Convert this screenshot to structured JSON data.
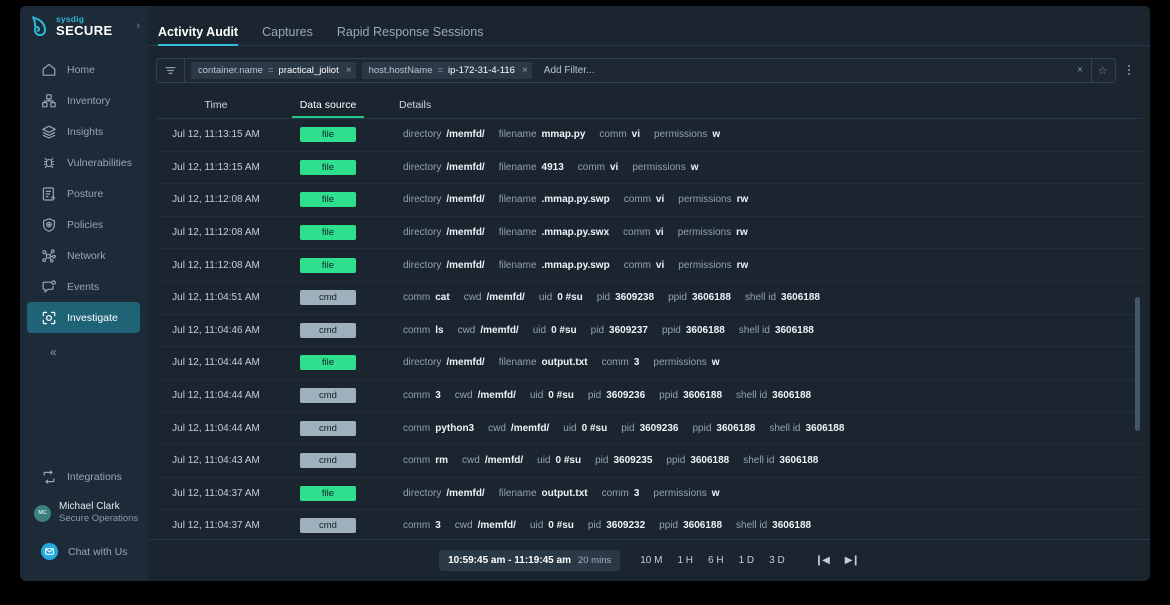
{
  "brand": {
    "top": "sysdig",
    "bottom": "SECURE",
    "chevron": "›"
  },
  "sidebar": {
    "items": [
      {
        "label": "Home",
        "icon": "home-icon"
      },
      {
        "label": "Inventory",
        "icon": "inventory-icon"
      },
      {
        "label": "Insights",
        "icon": "insights-icon"
      },
      {
        "label": "Vulnerabilities",
        "icon": "bug-icon"
      },
      {
        "label": "Posture",
        "icon": "posture-icon"
      },
      {
        "label": "Policies",
        "icon": "shield-icon"
      },
      {
        "label": "Network",
        "icon": "network-icon"
      },
      {
        "label": "Events",
        "icon": "events-icon"
      },
      {
        "label": "Investigate",
        "icon": "investigate-icon",
        "active": true
      }
    ],
    "collapse_glyph": "«",
    "integrations": {
      "label": "Integrations",
      "icon": "integrations-icon"
    },
    "user": {
      "initials": "MC",
      "name": "Michael Clark",
      "role": "Secure Operations"
    },
    "chat": {
      "label": "Chat with Us",
      "icon": "chat-icon"
    }
  },
  "tabs": [
    {
      "label": "Activity Audit",
      "active": true
    },
    {
      "label": "Captures",
      "active": false
    },
    {
      "label": "Rapid Response Sessions",
      "active": false
    }
  ],
  "filterbar": {
    "funnel_icon": "filter-icon",
    "chips": [
      {
        "key": "container.name",
        "op": "=",
        "value": "practical_joliot",
        "remove": "×"
      },
      {
        "key": "host.hostName",
        "op": "=",
        "value": "ip-172-31-4-116",
        "remove": "×"
      }
    ],
    "add_filter": "Add Filter...",
    "clear_glyph": "×",
    "star_glyph": "☆",
    "kebab_icon": "more-options-icon"
  },
  "table": {
    "columns": [
      {
        "label": "Time",
        "sorted": false
      },
      {
        "label": "Data source",
        "sorted": true
      },
      {
        "label": "Details",
        "sorted": false
      }
    ],
    "rows": [
      {
        "time": "Jul 12, 11:13:15 AM",
        "source": "file",
        "details": [
          [
            "directory",
            "/memfd/"
          ],
          [
            "filename",
            "mmap.py"
          ],
          [
            "comm",
            "vi"
          ],
          [
            "permissions",
            "w"
          ]
        ]
      },
      {
        "time": "Jul 12, 11:13:15 AM",
        "source": "file",
        "details": [
          [
            "directory",
            "/memfd/"
          ],
          [
            "filename",
            "4913"
          ],
          [
            "comm",
            "vi"
          ],
          [
            "permissions",
            "w"
          ]
        ]
      },
      {
        "time": "Jul 12, 11:12:08 AM",
        "source": "file",
        "details": [
          [
            "directory",
            "/memfd/"
          ],
          [
            "filename",
            ".mmap.py.swp"
          ],
          [
            "comm",
            "vi"
          ],
          [
            "permissions",
            "rw"
          ]
        ]
      },
      {
        "time": "Jul 12, 11:12:08 AM",
        "source": "file",
        "details": [
          [
            "directory",
            "/memfd/"
          ],
          [
            "filename",
            ".mmap.py.swx"
          ],
          [
            "comm",
            "vi"
          ],
          [
            "permissions",
            "rw"
          ]
        ]
      },
      {
        "time": "Jul 12, 11:12:08 AM",
        "source": "file",
        "details": [
          [
            "directory",
            "/memfd/"
          ],
          [
            "filename",
            ".mmap.py.swp"
          ],
          [
            "comm",
            "vi"
          ],
          [
            "permissions",
            "rw"
          ]
        ]
      },
      {
        "time": "Jul 12, 11:04:51 AM",
        "source": "cmd",
        "details": [
          [
            "comm",
            "cat"
          ],
          [
            "cwd",
            "/memfd/"
          ],
          [
            "uid",
            "0 #su"
          ],
          [
            "pid",
            "3609238"
          ],
          [
            "ppid",
            "3606188"
          ],
          [
            "shell id",
            "3606188"
          ]
        ]
      },
      {
        "time": "Jul 12, 11:04:46 AM",
        "source": "cmd",
        "details": [
          [
            "comm",
            "ls"
          ],
          [
            "cwd",
            "/memfd/"
          ],
          [
            "uid",
            "0 #su"
          ],
          [
            "pid",
            "3609237"
          ],
          [
            "ppid",
            "3606188"
          ],
          [
            "shell id",
            "3606188"
          ]
        ]
      },
      {
        "time": "Jul 12, 11:04:44 AM",
        "source": "file",
        "details": [
          [
            "directory",
            "/memfd/"
          ],
          [
            "filename",
            "output.txt"
          ],
          [
            "comm",
            "3"
          ],
          [
            "permissions",
            "w"
          ]
        ]
      },
      {
        "time": "Jul 12, 11:04:44 AM",
        "source": "cmd",
        "details": [
          [
            "comm",
            "3"
          ],
          [
            "cwd",
            "/memfd/"
          ],
          [
            "uid",
            "0 #su"
          ],
          [
            "pid",
            "3609236"
          ],
          [
            "ppid",
            "3606188"
          ],
          [
            "shell id",
            "3606188"
          ]
        ]
      },
      {
        "time": "Jul 12, 11:04:44 AM",
        "source": "cmd",
        "details": [
          [
            "comm",
            "python3"
          ],
          [
            "cwd",
            "/memfd/"
          ],
          [
            "uid",
            "0 #su"
          ],
          [
            "pid",
            "3609236"
          ],
          [
            "ppid",
            "3606188"
          ],
          [
            "shell id",
            "3606188"
          ]
        ]
      },
      {
        "time": "Jul 12, 11:04:43 AM",
        "source": "cmd",
        "details": [
          [
            "comm",
            "rm"
          ],
          [
            "cwd",
            "/memfd/"
          ],
          [
            "uid",
            "0 #su"
          ],
          [
            "pid",
            "3609235"
          ],
          [
            "ppid",
            "3606188"
          ],
          [
            "shell id",
            "3606188"
          ]
        ]
      },
      {
        "time": "Jul 12, 11:04:37 AM",
        "source": "file",
        "details": [
          [
            "directory",
            "/memfd/"
          ],
          [
            "filename",
            "output.txt"
          ],
          [
            "comm",
            "3"
          ],
          [
            "permissions",
            "w"
          ]
        ]
      },
      {
        "time": "Jul 12, 11:04:37 AM",
        "source": "cmd",
        "details": [
          [
            "comm",
            "3"
          ],
          [
            "cwd",
            "/memfd/"
          ],
          [
            "uid",
            "0 #su"
          ],
          [
            "pid",
            "3609232"
          ],
          [
            "ppid",
            "3606188"
          ],
          [
            "shell id",
            "3606188"
          ]
        ]
      }
    ]
  },
  "bottombar": {
    "range": "10:59:45 am - 11:19:45 am",
    "duration": "20 mins",
    "presets": [
      "10 M",
      "1 H",
      "6 H",
      "1 D",
      "3 D"
    ],
    "prev_glyph": "❙◀",
    "next_glyph": "▶❙"
  },
  "colors": {
    "accent_teal": "#2dbfd9",
    "accent_green": "#2ee08e",
    "sort_green": "#24c98a",
    "badge_cmd": "#9fb0bd",
    "active_nav": "#1f6476",
    "sidebar_bg": "#1d2b38",
    "main_bg": "#1b2530"
  }
}
